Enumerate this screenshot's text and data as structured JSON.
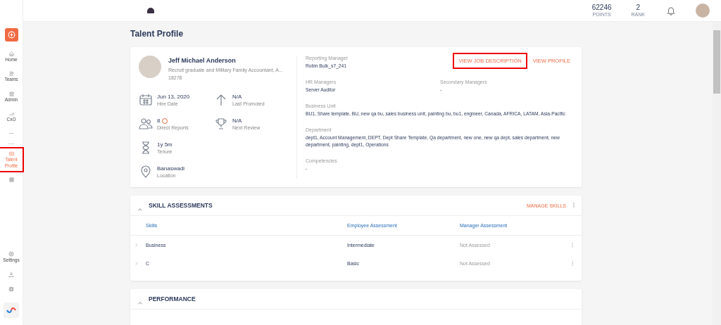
{
  "topbar": {
    "stats": [
      {
        "value": "62246",
        "label": "POINTS"
      },
      {
        "value": "2",
        "label": "RANK"
      }
    ]
  },
  "sidebar": {
    "items": [
      {
        "kind": "home",
        "label": "Home",
        "selected": false,
        "highlighted": false
      },
      {
        "kind": "teams",
        "label": "Teams",
        "selected": false,
        "highlighted": false
      },
      {
        "kind": "admin",
        "label": "Admin",
        "selected": false,
        "highlighted": false
      },
      {
        "kind": "cxo",
        "label": "CxO",
        "selected": false,
        "highlighted": false
      },
      {
        "kind": "more",
        "label": "···",
        "selected": false,
        "highlighted": false
      },
      {
        "kind": "talent",
        "label": "Talent Profile",
        "selected": true,
        "highlighted": true
      },
      {
        "kind": "grid",
        "selected": false,
        "highlighted": false
      }
    ],
    "bottom_items": [
      {
        "kind": "settings",
        "label": "Settings"
      },
      {
        "kind": "download"
      },
      {
        "kind": "help"
      }
    ]
  },
  "page_title": "Talent Profile",
  "profile": {
    "name": "Jeff Michael Anderson",
    "role": "Recruit graduate and Military Family Accountant, A...",
    "id": "18278",
    "facts": [
      {
        "kind": "calendar",
        "value": "Jun 13, 2020",
        "label": "Hire Date"
      },
      {
        "kind": "arrow",
        "value": "N/A",
        "label": "Last Promoted"
      },
      {
        "kind": "people",
        "value": "8",
        "label": "Direct Reports",
        "has_link": true
      },
      {
        "kind": "trophy",
        "value": "N/A",
        "label": "Next Review"
      },
      {
        "kind": "hourglass",
        "value": "1y 5m",
        "label": "Tenure"
      },
      {
        "kind": "location",
        "value": "Banaswadi",
        "label": "Location"
      }
    ],
    "fields": [
      {
        "label": "Reporting Manager",
        "value": "Robin Bulk_s7_241",
        "half": false
      },
      {
        "label": "HR Managers",
        "value": "Server Auditor",
        "half": true
      },
      {
        "label": "Secondary Managers",
        "value": "-",
        "half": true
      },
      {
        "label": "Business Unit",
        "value": "BU1, Share template, BU, new qa bu, sales business unit, painting bu, bu1, engineer, Canada, AFRICA, LATAM, Asia-Pacific",
        "half": false
      },
      {
        "label": "Department",
        "value": "dept1, Account Management, DEPT, Dept Share Template, Qa department, new one, new qa dept, sales department, new department, painting, dept1, Operations",
        "half": false
      },
      {
        "label": "Competencies",
        "value": "-",
        "half": false
      }
    ],
    "links": [
      {
        "label": "VIEW JOB DESCRIPTION",
        "highlighted": true
      },
      {
        "label": "VIEW PROFILE",
        "highlighted": false
      }
    ]
  },
  "skills": {
    "title": "SKILL ASSESSMENTS",
    "expanded": true,
    "action": "MANAGE SKILLS",
    "columns": [
      "Skills",
      "Employee Assessment",
      "Manager Assessment"
    ],
    "rows": [
      {
        "skill": "Business",
        "employee": "Intermediate",
        "manager": "Not Assessed"
      },
      {
        "skill": "C",
        "employee": "Basic",
        "manager": "Not Assessed"
      }
    ]
  },
  "performance": {
    "title": "PERFORMANCE",
    "expanded": true
  }
}
